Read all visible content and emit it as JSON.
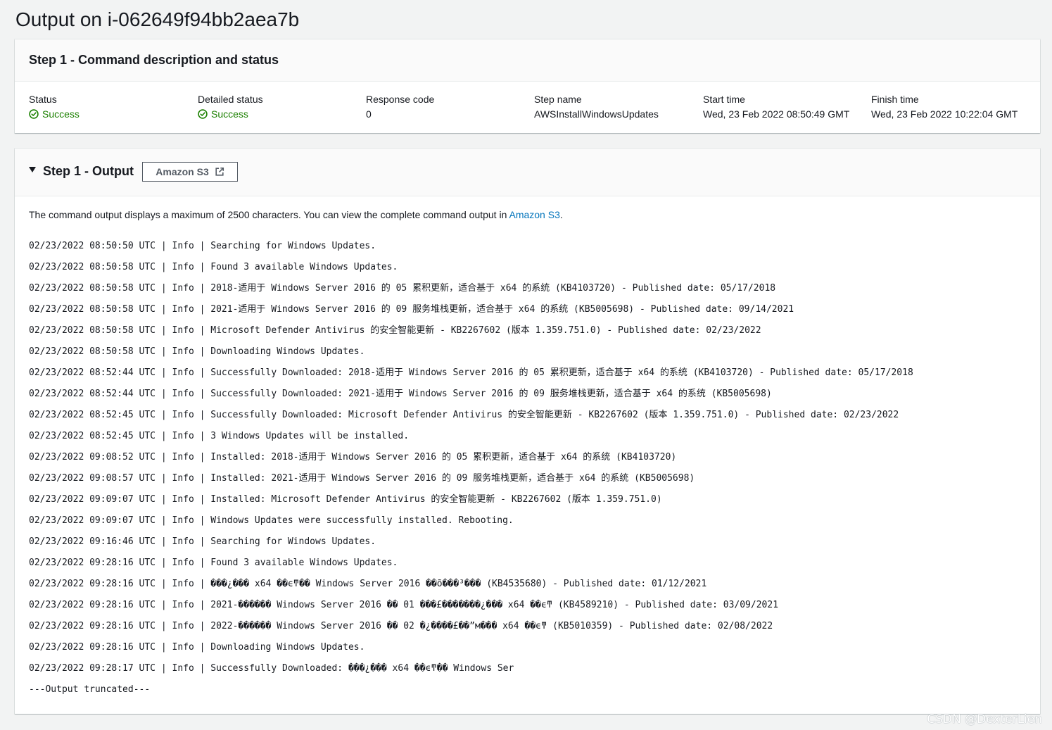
{
  "page": {
    "title": "Output on i-062649f94bb2aea7b"
  },
  "step_status": {
    "title": "Step 1 - Command description and status",
    "columns": [
      {
        "label": "Status",
        "value": "Success",
        "success": true
      },
      {
        "label": "Detailed status",
        "value": "Success",
        "success": true
      },
      {
        "label": "Response code",
        "value": "0",
        "success": false
      },
      {
        "label": "Step name",
        "value": "AWSInstallWindowsUpdates",
        "success": false
      },
      {
        "label": "Start time",
        "value": "Wed, 23 Feb 2022 08:50:49 GMT",
        "success": false
      },
      {
        "label": "Finish time",
        "value": "Wed, 23 Feb 2022 10:22:04 GMT",
        "success": false
      }
    ]
  },
  "step_output": {
    "title": "Step 1 - Output",
    "s3_button_label": "Amazon S3",
    "note_prefix": "The command output displays a maximum of 2500 characters. You can view the complete command output in ",
    "note_link": "Amazon S3",
    "note_suffix": ".",
    "lines": [
      "02/23/2022 08:50:50 UTC | Info | Searching for Windows Updates.",
      "02/23/2022 08:50:58 UTC | Info | Found 3 available Windows Updates.",
      "02/23/2022 08:50:58 UTC | Info | 2018-适用于 Windows Server 2016 的 05 累积更新，适合基于 x64 的系统 (KB4103720) - Published date: 05/17/2018",
      "02/23/2022 08:50:58 UTC | Info | 2021-适用于 Windows Server 2016 的 09 服务堆栈更新，适合基于 x64 的系统 (KB5005698) - Published date: 09/14/2021",
      "02/23/2022 08:50:58 UTC | Info | Microsoft Defender Antivirus 的安全智能更新 - KB2267602 (版本 1.359.751.0) - Published date: 02/23/2022",
      "02/23/2022 08:50:58 UTC | Info | Downloading Windows Updates.",
      "02/23/2022 08:52:44 UTC | Info | Successfully Downloaded: 2018-适用于 Windows Server 2016 的 05 累积更新，适合基于 x64 的系统 (KB4103720) - Published date: 05/17/2018",
      "02/23/2022 08:52:44 UTC | Info | Successfully Downloaded: 2021-适用于 Windows Server 2016 的 09 服务堆栈更新，适合基于 x64 的系统 (KB5005698)",
      "02/23/2022 08:52:45 UTC | Info | Successfully Downloaded: Microsoft Defender Antivirus 的安全智能更新 - KB2267602 (版本 1.359.751.0) - Published date: 02/23/2022",
      "02/23/2022 08:52:45 UTC | Info | 3 Windows Updates will be installed.",
      "02/23/2022 09:08:52 UTC | Info | Installed: 2018-适用于 Windows Server 2016 的 05 累积更新，适合基于 x64 的系统 (KB4103720)",
      "02/23/2022 09:08:57 UTC | Info | Installed: 2021-适用于 Windows Server 2016 的 09 服务堆栈更新，适合基于 x64 的系统 (KB5005698)",
      "02/23/2022 09:09:07 UTC | Info | Installed: Microsoft Defender Antivirus 的安全智能更新 - KB2267602 (版本 1.359.751.0)",
      "02/23/2022 09:09:07 UTC | Info | Windows Updates were successfully installed. Rebooting.",
      "02/23/2022 09:16:46 UTC | Info | Searching for Windows Updates.",
      "02/23/2022 09:28:16 UTC | Info | Found 3 available Windows Updates.",
      "02/23/2022 09:28:16 UTC | Info | ���¿��� x64 ��ϵͳ�� Windows Server 2016 ��õ���³��� (KB4535680) - Published date: 01/12/2021",
      "02/23/2022 09:28:16 UTC | Info | 2021-������ Windows Server 2016 �� 01 ���£�������¿��� x64 ��ϵͳ (KB4589210) - Published date: 03/09/2021",
      "02/23/2022 09:28:16 UTC | Info | 2022-������ Windows Server 2016 �� 02 �¿����£��”м��� x64 ��ϵͳ (KB5010359) - Published date: 02/08/2022",
      "02/23/2022 09:28:16 UTC | Info | Downloading Windows Updates.",
      "02/23/2022 09:28:17 UTC | Info | Successfully Downloaded: ���¿��� x64 ��ϵͳ�� Windows Ser",
      "---Output truncated---"
    ]
  },
  "watermark": "CSDN @DexterLien",
  "colors": {
    "success": "#1d8102",
    "link": "#0073bb",
    "background": "#f2f3f3"
  }
}
